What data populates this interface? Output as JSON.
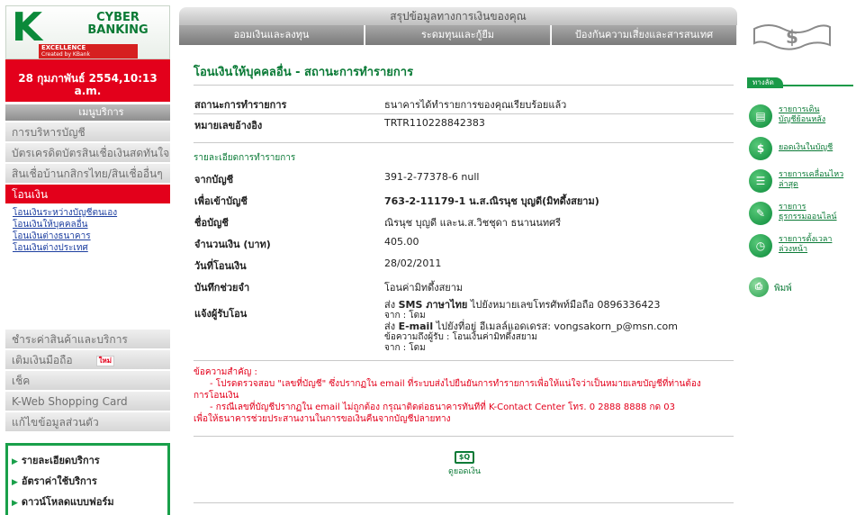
{
  "brand": {
    "logo_letter": "K",
    "logo_text_1": "CYBER",
    "logo_text_2": "BANKING",
    "excellence": "EXCELLENCE",
    "excellence_sub": "Created by KBank"
  },
  "date_time": "28 กุมภาพันธ์ 2554,10:13 a.m.",
  "menu": {
    "header": "เมนูบริการ",
    "items": [
      "การบริหารบัญชี",
      "บัตรเครดิตบัตรสินเชื่อเงินสดทันใจ",
      "สินเชื่อบ้านกสิกรไทย/สินเชื่ออื่นๆ",
      "โอนเงิน"
    ],
    "submenu": [
      "โอนเงินระหว่างบัญชีตนเอง",
      "โอนเงินให้บุคคลอื่น",
      "โอนเงินต่างธนาคาร",
      "โอนเงินต่างประเทศ"
    ],
    "items_bottom": [
      "ชำระค่าสินค้าและบริการ",
      "เติมเงินมือถือ",
      "เช็ค",
      "K-Web Shopping Card",
      "แก้ไขข้อมูลส่วนตัว"
    ],
    "new_badge": "ใหม่"
  },
  "bottom_links": [
    "รายละเอียดบริการ",
    "อัตราค่าใช้บริการ",
    "ดาวน์โหลดแบบฟอร์ม"
  ],
  "tabs": {
    "summary": "สรุปข้อมูลทางการเงินของคุณ",
    "items": [
      "ออมเงินและลงทุน",
      "ระดมทุนและกู้ยืม",
      "ป้องกันความเสี่ยงและสารสนเทศ"
    ]
  },
  "page_title": "โอนเงินให้บุคคลอื่น - สถานะการทำรายการ",
  "status": {
    "label": "สถานะการทำรายการ",
    "value": "ธนาคารได้ทำรายการของคุณเรียบร้อยแล้ว"
  },
  "reference": {
    "label": "หมายเลขอ้างอิง",
    "value": "TRTR110228842383"
  },
  "details_heading": "รายละเอียดการทำรายการ",
  "details": [
    {
      "label": "จากบัญชี",
      "value": "391-2-77378-6 null"
    },
    {
      "label": "เพื่อเข้าบัญชี",
      "value": "763-2-11179-1 น.ส.ณิรนุช บุญดี(มิทดึ้งสยาม)"
    },
    {
      "label": "ชื่อบัญชี",
      "value": "ณิรนุช บุญดี และน.ส.วิชชุดา ธนานนทศรี"
    },
    {
      "label": "จำนวนเงิน (บาท)",
      "value": "405.00"
    },
    {
      "label": "วันที่โอนเงิน",
      "value": "28/02/2011"
    },
    {
      "label": "บันทึกช่วยจำ",
      "value": "โอนค่ามิทดึ้งสยาม"
    }
  ],
  "notify": {
    "label": "แจ้งผู้รับโอน",
    "sms_prefix": "ส่ง",
    "sms_bold": "SMS ภาษาไทย",
    "sms_rest": "ไปยังหมายเลขโทรศัพท์มือถือ 0896336423",
    "sms_from": "จาก : โดม",
    "email_prefix": "ส่ง",
    "email_bold": "E-mail",
    "email_rest": "ไปยังที่อยู่ อีเมลล์แอดเดรส: vongsakorn_p@msn.com",
    "email_message": "ข้อความถึงผู้รับ : โอนเงินค่ามิทดึ้งสยาม",
    "email_from": "จาก : โดม"
  },
  "important": {
    "heading": "ข้อความสำคัญ :",
    "line1": "- โปรดตรวจสอบ \"เลขที่บัญชี\" ซึ่งปรากฏใน email ที่ระบบส่งไปยืนยันการทำรายการเพื่อให้แน่ใจว่าเป็นหมายเลขบัญชีที่ท่านต้อง",
    "line1b": "การโอนเงิน",
    "line2": "- กรณีเลขที่บัญชีปรากฏใน email ไม่ถูกต้อง กรุณาติดต่อธนาคารทันทีที่ K-Contact Center โทร. 0 2888 8888 กด 03",
    "line2b": "เพื่อให้ธนาคารช่วยประสานงานในการขอเงินคืนจากบัญชีปลายทาง"
  },
  "view_balance": "ดูยอดเงิน",
  "right": {
    "shortcut_tab": "ทางลัด",
    "shortcuts": [
      {
        "icon": "balance-sheet-icon",
        "line1": "รายการเดิน",
        "line2": "บัญชีย้อนหลัง"
      },
      {
        "icon": "dollar-coin-icon",
        "line1": "ยอดเงินในบัญชี",
        "line2": ""
      },
      {
        "icon": "recent-document-icon",
        "line1": "รายการเคลื่อนไหว",
        "line2": "ล่าสุด"
      },
      {
        "icon": "online-transaction-icon",
        "line1": "รายการ",
        "line2": "ธุรกรรมออนไลน์"
      },
      {
        "icon": "clock-icon",
        "line1": "รายการตั้งเวลา",
        "line2": "ล่วงหน้า"
      }
    ],
    "print": "พิมพ์"
  },
  "colors": {
    "brand_green": "#0b8a3a",
    "brand_red": "#e3001b",
    "link_blue": "#1d3fa0",
    "tab_gray": "#8e8e8e"
  }
}
